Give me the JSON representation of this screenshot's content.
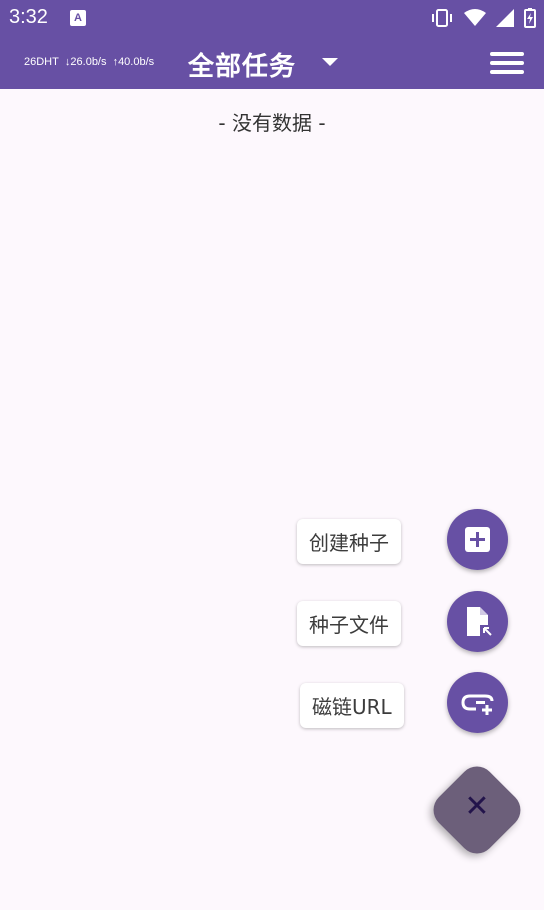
{
  "status_bar": {
    "time": "3:32",
    "notification_icon": "font-icon",
    "icons": [
      "vibrate-icon",
      "wifi-icon",
      "signal-icon",
      "battery-icon"
    ]
  },
  "app_bar": {
    "dht": "26DHT",
    "download": "↓26.0b/s",
    "upload": "↑40.0b/s",
    "title": "全部任务"
  },
  "main": {
    "empty_text": "- 没有数据 -"
  },
  "fab_menu": {
    "create_torrent": "创建种子",
    "torrent_file": "种子文件",
    "magnet_url": "磁链URL"
  },
  "colors": {
    "primary": "#6750a4",
    "fab_main": "#6c5f7a",
    "background": "#fdf8fd"
  }
}
